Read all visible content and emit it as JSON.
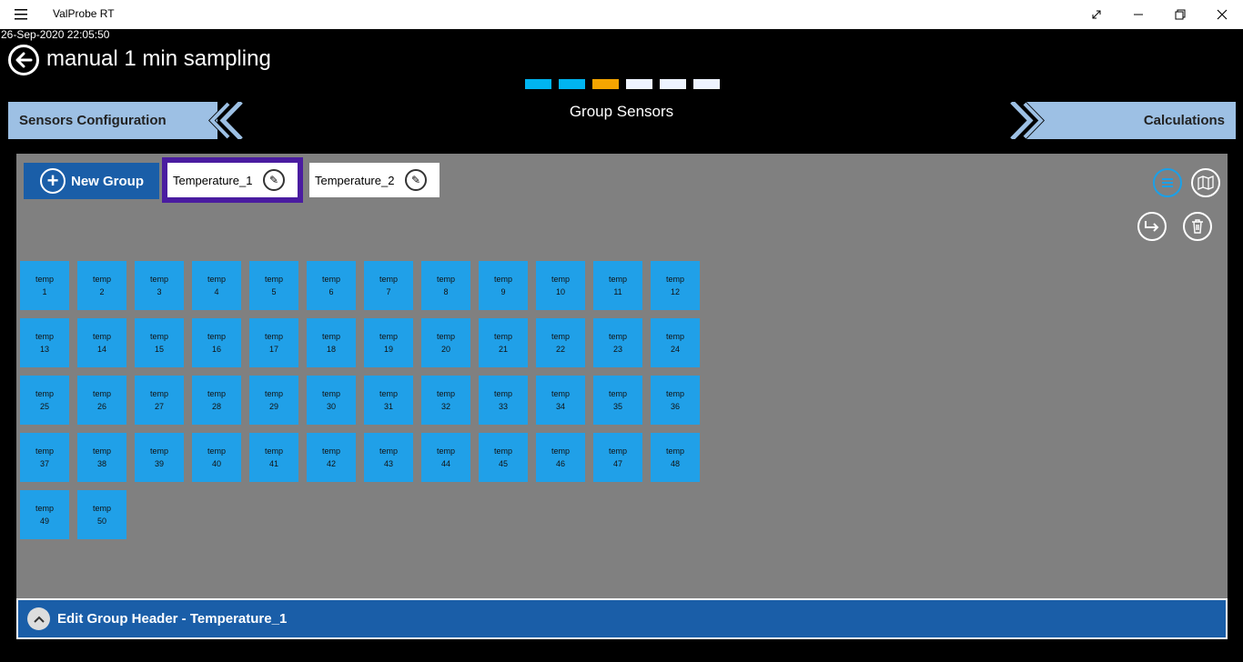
{
  "window": {
    "app_title": "ValProbe RT",
    "menu_icon": "hamburger-icon",
    "controls": [
      "resize-icon",
      "minimize-icon",
      "restore-icon",
      "close-icon"
    ]
  },
  "timestamp": "26-Sep-2020 22:05:50",
  "header": {
    "title": "manual 1 min sampling",
    "back_icon": "back-arrow-icon"
  },
  "steps": [
    {
      "color": "#00b4f0"
    },
    {
      "color": "#00b4f0"
    },
    {
      "color": "#f5a500"
    },
    {
      "color": "#eef4ff"
    },
    {
      "color": "#eef4ff"
    },
    {
      "color": "#eef4ff"
    }
  ],
  "nav": {
    "prev_label": "Sensors Configuration",
    "current_label": "Group Sensors",
    "next_label": "Calculations"
  },
  "groups": {
    "new_group_label": "New Group",
    "tabs": [
      {
        "label": "Temperature_1",
        "selected": true
      },
      {
        "label": "Temperature_2",
        "selected": false
      }
    ]
  },
  "sensors": {
    "prefix": "temp",
    "items": [
      "1",
      "2",
      "3",
      "4",
      "5",
      "6",
      "7",
      "8",
      "9",
      "10",
      "11",
      "12",
      "13",
      "14",
      "15",
      "16",
      "17",
      "18",
      "19",
      "20",
      "21",
      "22",
      "23",
      "24",
      "25",
      "26",
      "27",
      "28",
      "29",
      "30",
      "31",
      "32",
      "33",
      "34",
      "35",
      "36",
      "37",
      "38",
      "39",
      "40",
      "41",
      "42",
      "43",
      "44",
      "45",
      "46",
      "47",
      "48",
      "49",
      "50"
    ]
  },
  "footer": {
    "label": "Edit Group Header - Temperature_1"
  },
  "colors": {
    "accent": "#1a5ea8",
    "tile": "#20a0e8",
    "panel": "#808080",
    "nav": "#9dc0e4",
    "selected_outline": "#4a1ca0"
  }
}
